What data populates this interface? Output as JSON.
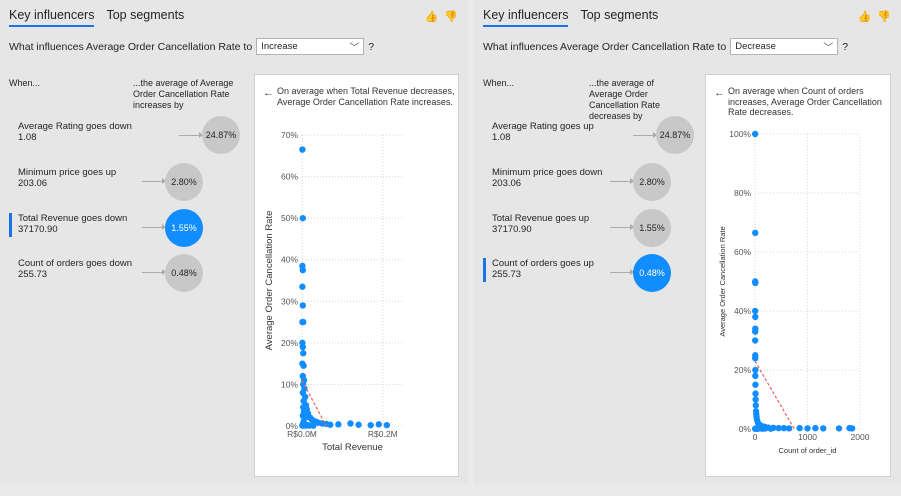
{
  "left": {
    "tabs": [
      "Key influencers",
      "Top segments"
    ],
    "question": "What influences Average Order Cancellation Rate to",
    "dropdown_value": "Increase",
    "qmark": "?",
    "when_header": "When...",
    "avg_header": "...the average of Average Order Cancellation Rate increases by",
    "influencers": [
      {
        "label": "Average Rating goes down",
        "value": "1.08",
        "bubble": "24.87%",
        "selected": false
      },
      {
        "label": "Minimum price goes up",
        "value": "203.06",
        "bubble": "2.80%",
        "selected": false
      },
      {
        "label": "Total Revenue goes down",
        "value": "37170.90",
        "bubble": "1.55%",
        "selected": true
      },
      {
        "label": "Count of orders goes down",
        "value": "255.73",
        "bubble": "0.48%",
        "selected": false
      }
    ],
    "detail": {
      "back": "←",
      "description": "On average when Total Revenue decreases, Average Order Cancellation Rate increases.",
      "chart_data": {
        "type": "scatter",
        "xlabel": "Total Revenue",
        "ylabel": "Average Order Cancellation Rate",
        "yticks": [
          "0%",
          "10%",
          "20%",
          "30%",
          "40%",
          "50%",
          "60%",
          "70%"
        ],
        "xticks": [
          "R$0.0M",
          "R$0.2M"
        ],
        "ylim": [
          0,
          0.7
        ],
        "xlim": [
          0,
          0.25
        ],
        "grid": true,
        "trendline": [
          [
            0,
            0.11
          ],
          [
            0.06,
            0
          ]
        ],
        "points": [
          [
            0.001,
            0.665
          ],
          [
            0.002,
            0.5
          ],
          [
            0.001,
            0.385
          ],
          [
            0.002,
            0.375
          ],
          [
            0.001,
            0.335
          ],
          [
            0.002,
            0.29
          ],
          [
            0.001,
            0.25
          ],
          [
            0.003,
            0.25
          ],
          [
            0.001,
            0.2
          ],
          [
            0.002,
            0.19
          ],
          [
            0.003,
            0.175
          ],
          [
            0.001,
            0.15
          ],
          [
            0.004,
            0.145
          ],
          [
            0.002,
            0.12
          ],
          [
            0.005,
            0.11
          ],
          [
            0.003,
            0.1
          ],
          [
            0.006,
            0.09
          ],
          [
            0.002,
            0.08
          ],
          [
            0.008,
            0.07
          ],
          [
            0.004,
            0.06
          ],
          [
            0.01,
            0.05
          ],
          [
            0.003,
            0.045
          ],
          [
            0.012,
            0.04
          ],
          [
            0.005,
            0.035
          ],
          [
            0.015,
            0.03
          ],
          [
            0.002,
            0.025
          ],
          [
            0.02,
            0.02
          ],
          [
            0.006,
            0.018
          ],
          [
            0.025,
            0.015
          ],
          [
            0.03,
            0.012
          ],
          [
            0.004,
            0.01
          ],
          [
            0.035,
            0.01
          ],
          [
            0.04,
            0.008
          ],
          [
            0.05,
            0.006
          ],
          [
            0.06,
            0.005
          ],
          [
            0.002,
            0.004
          ],
          [
            0.008,
            0.003
          ],
          [
            0.015,
            0.002
          ],
          [
            0.07,
            0.003
          ],
          [
            0.09,
            0.004
          ],
          [
            0.12,
            0.006
          ],
          [
            0.14,
            0.003
          ],
          [
            0.17,
            0.002
          ],
          [
            0.19,
            0.004
          ],
          [
            0.21,
            0.002
          ],
          [
            0.001,
            0.001
          ],
          [
            0.005,
            0.001
          ],
          [
            0.01,
            0.001
          ],
          [
            0.018,
            0.001
          ],
          [
            0.028,
            0.001
          ]
        ]
      }
    }
  },
  "right": {
    "tabs": [
      "Key influencers",
      "Top segments"
    ],
    "question": "What influences Average Order Cancellation Rate to",
    "dropdown_value": "Decrease",
    "qmark": "?",
    "when_header": "When...",
    "avg_header": "...the average of Average Order Cancellation Rate decreases by",
    "influencers": [
      {
        "label": "Average Rating goes up",
        "value": "1.08",
        "bubble": "24.87%",
        "selected": false
      },
      {
        "label": "Minimum price goes down",
        "value": "203.06",
        "bubble": "2.80%",
        "selected": false
      },
      {
        "label": "Total Revenue goes up",
        "value": "37170.90",
        "bubble": "1.55%",
        "selected": false
      },
      {
        "label": "Count of orders goes up",
        "value": "255.73",
        "bubble": "0.48%",
        "selected": true
      }
    ],
    "detail": {
      "back": "←",
      "description": "On average when Count of orders increases, Average Order Cancellation Rate decreases.",
      "chart_data": {
        "type": "scatter",
        "xlabel": "Count of order_id",
        "ylabel": "Average Order Cancellation Rate",
        "yticks": [
          "0%",
          "20%",
          "40%",
          "60%",
          "80%",
          "100%"
        ],
        "xticks": [
          "0",
          "1000",
          "2000"
        ],
        "ylim": [
          0,
          1.0
        ],
        "xlim": [
          0,
          2000
        ],
        "grid": true,
        "trendline": [
          [
            0,
            0.23
          ],
          [
            750,
            0
          ]
        ],
        "points": [
          [
            3,
            1.0
          ],
          [
            5,
            0.665
          ],
          [
            4,
            0.5
          ],
          [
            6,
            0.495
          ],
          [
            3,
            0.4
          ],
          [
            5,
            0.38
          ],
          [
            4,
            0.33
          ],
          [
            6,
            0.34
          ],
          [
            3,
            0.3
          ],
          [
            5,
            0.25
          ],
          [
            4,
            0.24
          ],
          [
            7,
            0.2
          ],
          [
            6,
            0.18
          ],
          [
            8,
            0.15
          ],
          [
            10,
            0.12
          ],
          [
            12,
            0.1
          ],
          [
            15,
            0.08
          ],
          [
            20,
            0.06
          ],
          [
            25,
            0.05
          ],
          [
            30,
            0.04
          ],
          [
            40,
            0.03
          ],
          [
            60,
            0.02
          ],
          [
            80,
            0.015
          ],
          [
            120,
            0.01
          ],
          [
            180,
            0.008
          ],
          [
            250,
            0.005
          ],
          [
            350,
            0.004
          ],
          [
            450,
            0.003
          ],
          [
            550,
            0.003
          ],
          [
            650,
            0.002
          ],
          [
            850,
            0.003
          ],
          [
            1000,
            0.002
          ],
          [
            1150,
            0.003
          ],
          [
            1300,
            0.002
          ],
          [
            1600,
            0.002
          ],
          [
            1800,
            0.003
          ],
          [
            1850,
            0.002
          ],
          [
            2,
            0.001
          ],
          [
            10,
            0.001
          ],
          [
            30,
            0.001
          ],
          [
            50,
            0.001
          ],
          [
            100,
            0.002
          ],
          [
            150,
            0.001
          ],
          [
            200,
            0.002
          ],
          [
            300,
            0.001
          ]
        ]
      }
    }
  }
}
